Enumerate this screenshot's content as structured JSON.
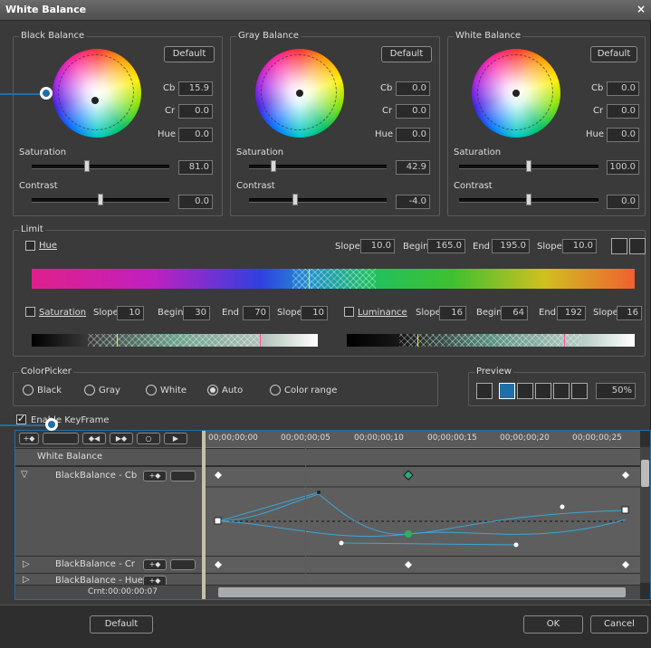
{
  "window": {
    "title": "White Balance",
    "close": "×"
  },
  "black_balance": {
    "title": "Black Balance",
    "default": "Default",
    "cb_label": "Cb",
    "cb": "15.9",
    "cr_label": "Cr",
    "cr": "0.0",
    "hue_label": "Hue",
    "hue": "0.0",
    "saturation_label": "Saturation",
    "saturation": "81.0",
    "contrast_label": "Contrast",
    "contrast": "0.0"
  },
  "gray_balance": {
    "title": "Gray Balance",
    "default": "Default",
    "cb_label": "Cb",
    "cb": "0.0",
    "cr_label": "Cr",
    "cr": "0.0",
    "hue_label": "Hue",
    "hue": "0.0",
    "saturation_label": "Saturation",
    "saturation": "42.9",
    "contrast_label": "Contrast",
    "contrast": "-4.0"
  },
  "white_balance": {
    "title": "White Balance",
    "default": "Default",
    "cb_label": "Cb",
    "cb": "0.0",
    "cr_label": "Cr",
    "cr": "0.0",
    "hue_label": "Hue",
    "hue": "0.0",
    "saturation_label": "Saturation",
    "saturation": "100.0",
    "contrast_label": "Contrast",
    "contrast": "0.0"
  },
  "limit": {
    "title": "Limit",
    "hue_label": "Hue",
    "slope_label": "Slope",
    "begin_label": "Begin",
    "end_label": "End",
    "hue_slope1": "10.0",
    "hue_begin": "165.0",
    "hue_end": "195.0",
    "hue_slope2": "10.0",
    "saturation_label": "Saturation",
    "sat_slope1": "10",
    "sat_begin": "30",
    "sat_end": "70",
    "sat_slope2": "10",
    "luminance_label": "Luminance",
    "lum_slope1": "16",
    "lum_begin": "64",
    "lum_end": "192",
    "lum_slope2": "16"
  },
  "colorpicker": {
    "title": "ColorPicker",
    "options": [
      "Black",
      "Gray",
      "White",
      "Auto",
      "Color range"
    ],
    "selected": "Auto"
  },
  "preview": {
    "title": "Preview",
    "zoom": "50%"
  },
  "keyframe": {
    "enable_label": "Enable KeyFrame"
  },
  "timeline": {
    "timecodes": [
      "00;00;00;00",
      "00;00;00;05",
      "00;00;00;10",
      "00;00;00;15",
      "00;00;00;20",
      "00;00;00;25"
    ],
    "group": "White Balance",
    "tracks": [
      "BlackBalance - Cb",
      "BlackBalance - Cr",
      "BlackBalance - Hue"
    ],
    "current": "Crnt:00:00:00:07"
  },
  "footer": {
    "default": "Default",
    "ok": "OK",
    "cancel": "Cancel"
  },
  "colors": {
    "accent": "#1f6fa8",
    "keyframe_green": "#2eb060",
    "cursor_red": "#c03030"
  }
}
